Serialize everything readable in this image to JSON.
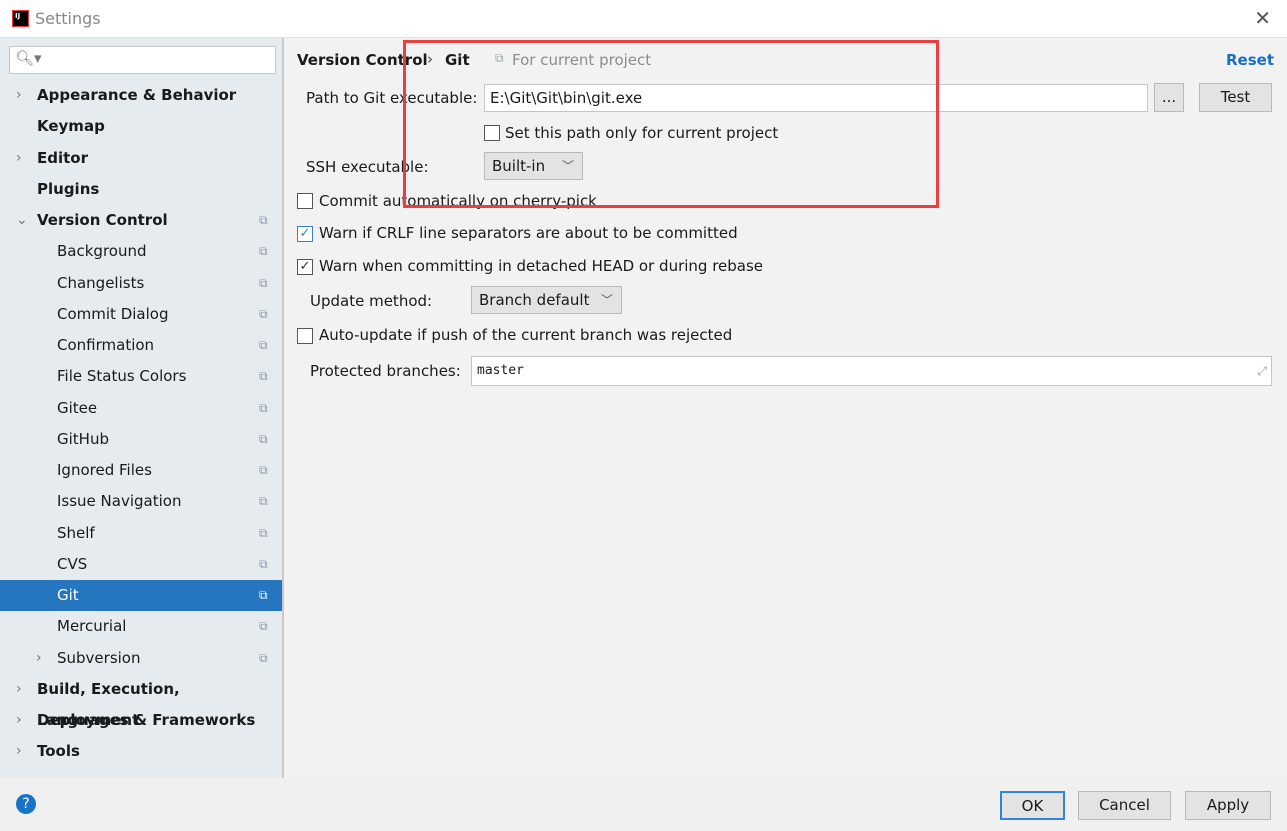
{
  "window": {
    "title": "Settings",
    "logo": "IJ"
  },
  "sidebar": {
    "search_placeholder": "",
    "items": [
      {
        "label": "Appearance & Behavior",
        "level": 0,
        "expandable": true
      },
      {
        "label": "Keymap",
        "level": 0
      },
      {
        "label": "Editor",
        "level": 0,
        "expandable": true
      },
      {
        "label": "Plugins",
        "level": 0
      },
      {
        "label": "Version Control",
        "level": 0,
        "expanded": true,
        "project": true
      },
      {
        "label": "Background",
        "level": 1,
        "project": true
      },
      {
        "label": "Changelists",
        "level": 1,
        "project": true
      },
      {
        "label": "Commit Dialog",
        "level": 1,
        "project": true
      },
      {
        "label": "Confirmation",
        "level": 1,
        "project": true
      },
      {
        "label": "File Status Colors",
        "level": 1,
        "project": true
      },
      {
        "label": "Gitee",
        "level": 1,
        "project": true
      },
      {
        "label": "GitHub",
        "level": 1,
        "project": true
      },
      {
        "label": "Ignored Files",
        "level": 1,
        "project": true
      },
      {
        "label": "Issue Navigation",
        "level": 1,
        "project": true
      },
      {
        "label": "Shelf",
        "level": 1,
        "project": true
      },
      {
        "label": "CVS",
        "level": 1,
        "project": true
      },
      {
        "label": "Git",
        "level": 1,
        "project": true,
        "selected": true
      },
      {
        "label": "Mercurial",
        "level": 1,
        "project": true
      },
      {
        "label": "Subversion",
        "level": 1,
        "project": true,
        "expandable": true
      },
      {
        "label": "Build, Execution, Deployment",
        "level": 0,
        "expandable": true
      },
      {
        "label": "Languages & Frameworks",
        "level": 0,
        "expandable": true
      },
      {
        "label": "Tools",
        "level": 0,
        "expandable": true
      }
    ]
  },
  "breadcrumb": {
    "parent": "Version Control",
    "current": "Git",
    "scope": "For current project",
    "reset": "Reset"
  },
  "form": {
    "git_path_label": "Path to Git executable:",
    "git_path_value": "E:\\Git\\Git\\bin\\git.exe",
    "browse": "...",
    "test": "Test",
    "current_project_only": {
      "label": "Set this path only for current project",
      "checked": false
    },
    "ssh_label": "SSH executable:",
    "ssh_value": "Built-in",
    "cherry_pick": {
      "label": "Commit automatically on cherry-pick",
      "checked": false
    },
    "crlf": {
      "label": "Warn if CRLF line separators are about to be committed",
      "checked": true
    },
    "detached": {
      "label": "Warn when committing in detached HEAD or during rebase",
      "checked": true
    },
    "update_label": "Update method:",
    "update_value": "Branch default",
    "auto_update": {
      "label": "Auto-update if push of the current branch was rejected",
      "checked": false
    },
    "protected_label": "Protected branches:",
    "protected_value": "master"
  },
  "footer": {
    "ok": "OK",
    "cancel": "Cancel",
    "apply": "Apply"
  },
  "colors": {
    "selection": "#2675bf",
    "link": "#1a6fc4",
    "highlight_box": "#e84040"
  }
}
